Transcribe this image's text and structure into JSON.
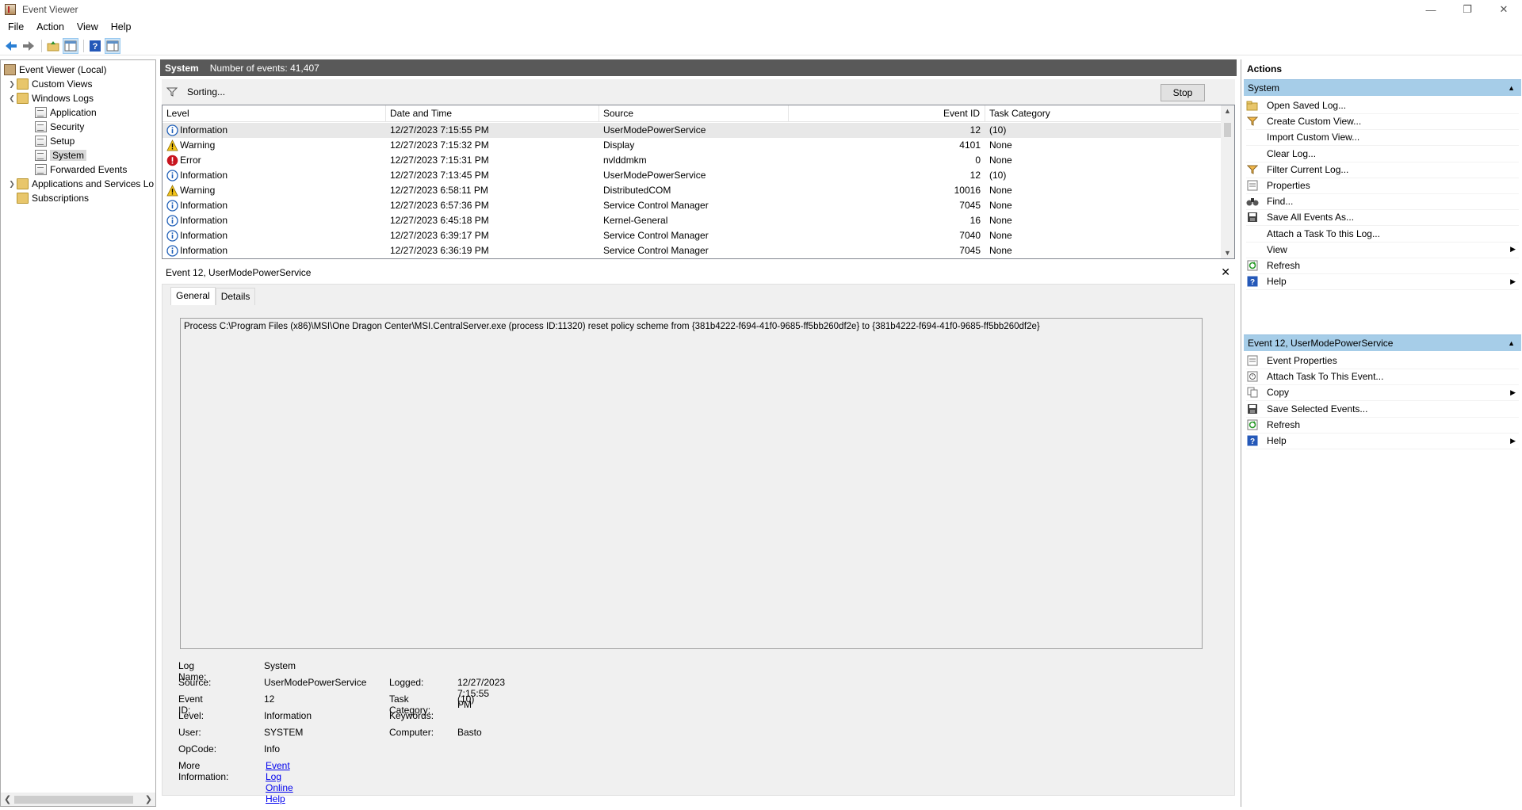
{
  "window": {
    "title": "Event Viewer"
  },
  "menu": [
    "File",
    "Action",
    "View",
    "Help"
  ],
  "tree": {
    "root": "Event Viewer (Local)",
    "custom_views": "Custom Views",
    "windows_logs": "Windows Logs",
    "logs": [
      "Application",
      "Security",
      "Setup",
      "System",
      "Forwarded Events"
    ],
    "apps_services": "Applications and Services Lo",
    "subscriptions": "Subscriptions"
  },
  "center": {
    "log_name": "System",
    "event_count": "Number of events: 41,407",
    "status": "Sorting...",
    "stop_label": "Stop",
    "columns": [
      "Level",
      "Date and Time",
      "Source",
      "Event ID",
      "Task Category"
    ],
    "rows": [
      {
        "level": "Information",
        "type": "info",
        "date": "12/27/2023 7:15:55 PM",
        "source": "UserModePowerService",
        "id": "12",
        "category": "(10)"
      },
      {
        "level": "Warning",
        "type": "warn",
        "date": "12/27/2023 7:15:32 PM",
        "source": "Display",
        "id": "4101",
        "category": "None"
      },
      {
        "level": "Error",
        "type": "error",
        "date": "12/27/2023 7:15:31 PM",
        "source": "nvlddmkm",
        "id": "0",
        "category": "None"
      },
      {
        "level": "Information",
        "type": "info",
        "date": "12/27/2023 7:13:45 PM",
        "source": "UserModePowerService",
        "id": "12",
        "category": "(10)"
      },
      {
        "level": "Warning",
        "type": "warn",
        "date": "12/27/2023 6:58:11 PM",
        "source": "DistributedCOM",
        "id": "10016",
        "category": "None"
      },
      {
        "level": "Information",
        "type": "info",
        "date": "12/27/2023 6:57:36 PM",
        "source": "Service Control Manager",
        "id": "7045",
        "category": "None"
      },
      {
        "level": "Information",
        "type": "info",
        "date": "12/27/2023 6:45:18 PM",
        "source": "Kernel-General",
        "id": "16",
        "category": "None"
      },
      {
        "level": "Information",
        "type": "info",
        "date": "12/27/2023 6:39:17 PM",
        "source": "Service Control Manager",
        "id": "7040",
        "category": "None"
      },
      {
        "level": "Information",
        "type": "info",
        "date": "12/27/2023 6:36:19 PM",
        "source": "Service Control Manager",
        "id": "7045",
        "category": "None"
      }
    ]
  },
  "detail": {
    "header": "Event 12, UserModePowerService",
    "tabs": [
      "General",
      "Details"
    ],
    "description": "Process C:\\Program Files (x86)\\MSI\\One Dragon Center\\MSI.CentralServer.exe (process ID:11320) reset policy scheme from {381b4222-f694-41f0-9685-ff5bb260df2e} to {381b4222-f694-41f0-9685-ff5bb260df2e}",
    "labels": {
      "log_name": "Log Name:",
      "source": "Source:",
      "event_id": "Event ID:",
      "level": "Level:",
      "user": "User:",
      "opcode": "OpCode:",
      "more_info": "More Information:",
      "logged": "Logged:",
      "task_category": "Task Category:",
      "keywords": "Keywords:",
      "computer": "Computer:"
    },
    "values": {
      "log_name": "System",
      "source": "UserModePowerService",
      "event_id": "12",
      "level": "Information",
      "user": "SYSTEM",
      "opcode": "Info",
      "more_info_link": "Event Log Online Help",
      "logged": "12/27/2023 7:15:55 PM",
      "task_category": "(10)",
      "keywords": "",
      "computer": "Basto"
    }
  },
  "actions": {
    "title": "Actions",
    "section1": "System",
    "items1": [
      {
        "label": "Open Saved Log...",
        "icon": "open-folder-icon"
      },
      {
        "label": "Create Custom View...",
        "icon": "filter-icon"
      },
      {
        "label": "Import Custom View...",
        "icon": ""
      },
      {
        "label": "Clear Log...",
        "icon": ""
      },
      {
        "label": "Filter Current Log...",
        "icon": "filter-icon"
      },
      {
        "label": "Properties",
        "icon": "properties-icon"
      },
      {
        "label": "Find...",
        "icon": "binoculars-icon"
      },
      {
        "label": "Save All Events As...",
        "icon": "save-icon"
      },
      {
        "label": "Attach a Task To this Log...",
        "icon": ""
      },
      {
        "label": "View",
        "icon": "",
        "submenu": true
      },
      {
        "label": "Refresh",
        "icon": "refresh-icon"
      },
      {
        "label": "Help",
        "icon": "help-icon",
        "submenu": true
      }
    ],
    "section2": "Event 12, UserModePowerService",
    "items2": [
      {
        "label": "Event Properties",
        "icon": "properties-icon"
      },
      {
        "label": "Attach Task To This Event...",
        "icon": "task-icon"
      },
      {
        "label": "Copy",
        "icon": "copy-icon",
        "submenu": true
      },
      {
        "label": "Save Selected Events...",
        "icon": "save-icon"
      },
      {
        "label": "Refresh",
        "icon": "refresh-icon"
      },
      {
        "label": "Help",
        "icon": "help-icon",
        "submenu": true
      }
    ]
  },
  "colors": {
    "header_bg": "#595959",
    "section_bg": "#a6cde8",
    "selected_row": "#e8e8e8"
  }
}
